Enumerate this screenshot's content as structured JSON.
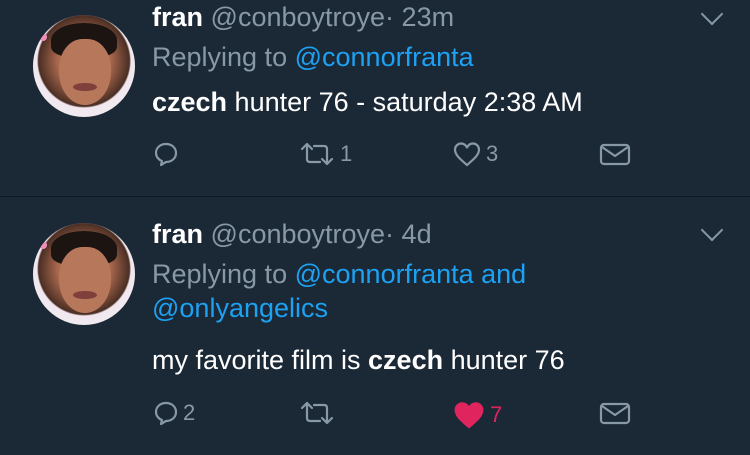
{
  "tweets": [
    {
      "name": "fran",
      "handle": "@conboytroye",
      "separator": "·",
      "time": "23m",
      "replying_prefix": "Replying to",
      "replying_to": "@connorfranta",
      "body_bold": "czech",
      "body_rest": " hunter 76 - saturday 2:38 AM",
      "reply_count": "",
      "retweet_count": "1",
      "like_count": "3",
      "liked": false
    },
    {
      "name": "fran",
      "handle": "@conboytroye",
      "separator": "·",
      "time": "4d",
      "replying_prefix": "Replying to",
      "replying_to": "@connorfranta and",
      "replying_to_2": "@onlyangelics",
      "body_prefix": "my favorite film is ",
      "body_bold": "czech",
      "body_rest": " hunter 76",
      "reply_count": "2",
      "retweet_count": "",
      "like_count": "7",
      "liked": true
    }
  ],
  "colors": {
    "background": "#1b2836",
    "muted": "#8899a6",
    "link": "#1da1f2",
    "like": "#e0245e"
  },
  "icons": [
    "reply-icon",
    "retweet-icon",
    "heart-icon",
    "direct-message-icon",
    "chevron-down-icon"
  ]
}
